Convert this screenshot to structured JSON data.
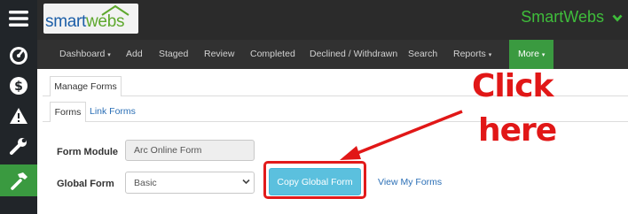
{
  "logo": {
    "part1": "smart",
    "part2": "webs"
  },
  "brand": {
    "name": "SmartWebs"
  },
  "sidebar": {
    "icons": [
      "menu-icon",
      "dashboard-gauge-icon",
      "dollar-icon",
      "warning-icon",
      "wrench-icon",
      "hammer-icon"
    ]
  },
  "nav": {
    "items": [
      "Dashboard",
      "Add",
      "Staged",
      "Review",
      "Completed",
      "Declined / Withdrawn",
      "Search",
      "Reports"
    ],
    "more": "More"
  },
  "panel": {
    "tab": "Manage Forms"
  },
  "subtabs": [
    "Forms",
    "Link Forms"
  ],
  "form": {
    "module_label": "Form Module",
    "module_value": "Arc Online Form",
    "global_label": "Global Form",
    "global_value": "Basic",
    "copy_button": "Copy Global Form",
    "view_link": "View My Forms"
  },
  "annotation": {
    "line1": "Click",
    "line2": "here"
  },
  "colors": {
    "accent_green": "#3fbd3b",
    "more_green": "#3a9a40",
    "button_blue": "#5bc0de",
    "annotation_red": "#e11717"
  }
}
